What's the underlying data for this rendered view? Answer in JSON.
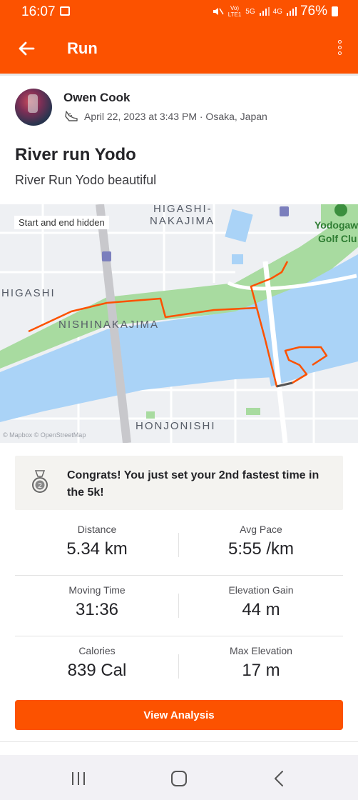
{
  "status_bar": {
    "time": "16:07",
    "network_labels": [
      "Vo)",
      "LTE1",
      "5G",
      "4G"
    ],
    "battery": "76%"
  },
  "appbar": {
    "title": "Run"
  },
  "athlete": {
    "name": "Owen Cook",
    "meta": "April 22, 2023 at 3:43 PM · Osaka, Japan"
  },
  "activity": {
    "title": "River run Yodo",
    "description": "River Run Yodo beautiful"
  },
  "map": {
    "privacy_label": "Start and end hidden",
    "places": [
      "HIGASHI-",
      "NAKAJIMA",
      "HIGASHI",
      "NISHINAKAJIMA",
      "HONJONISHI",
      "Yodogaw",
      "Golf Clu"
    ],
    "attribution": "© Mapbox © OpenStreetMap"
  },
  "achievement": {
    "text": "Congrats! You just set your 2nd fastest time in the 5k!",
    "badge": "2"
  },
  "stats": [
    [
      {
        "label": "Distance",
        "value": "5.34 km"
      },
      {
        "label": "Avg Pace",
        "value": "5:55 /km"
      }
    ],
    [
      {
        "label": "Moving Time",
        "value": "31:36"
      },
      {
        "label": "Elevation Gain",
        "value": "44 m"
      }
    ],
    [
      {
        "label": "Calories",
        "value": "839 Cal"
      },
      {
        "label": "Max Elevation",
        "value": "17 m"
      }
    ]
  ],
  "button": {
    "label": "View Analysis"
  },
  "colors": {
    "brand": "#fc5200",
    "route": "#fc5200",
    "water": "#aad3f7",
    "park": "#a8dba0"
  }
}
